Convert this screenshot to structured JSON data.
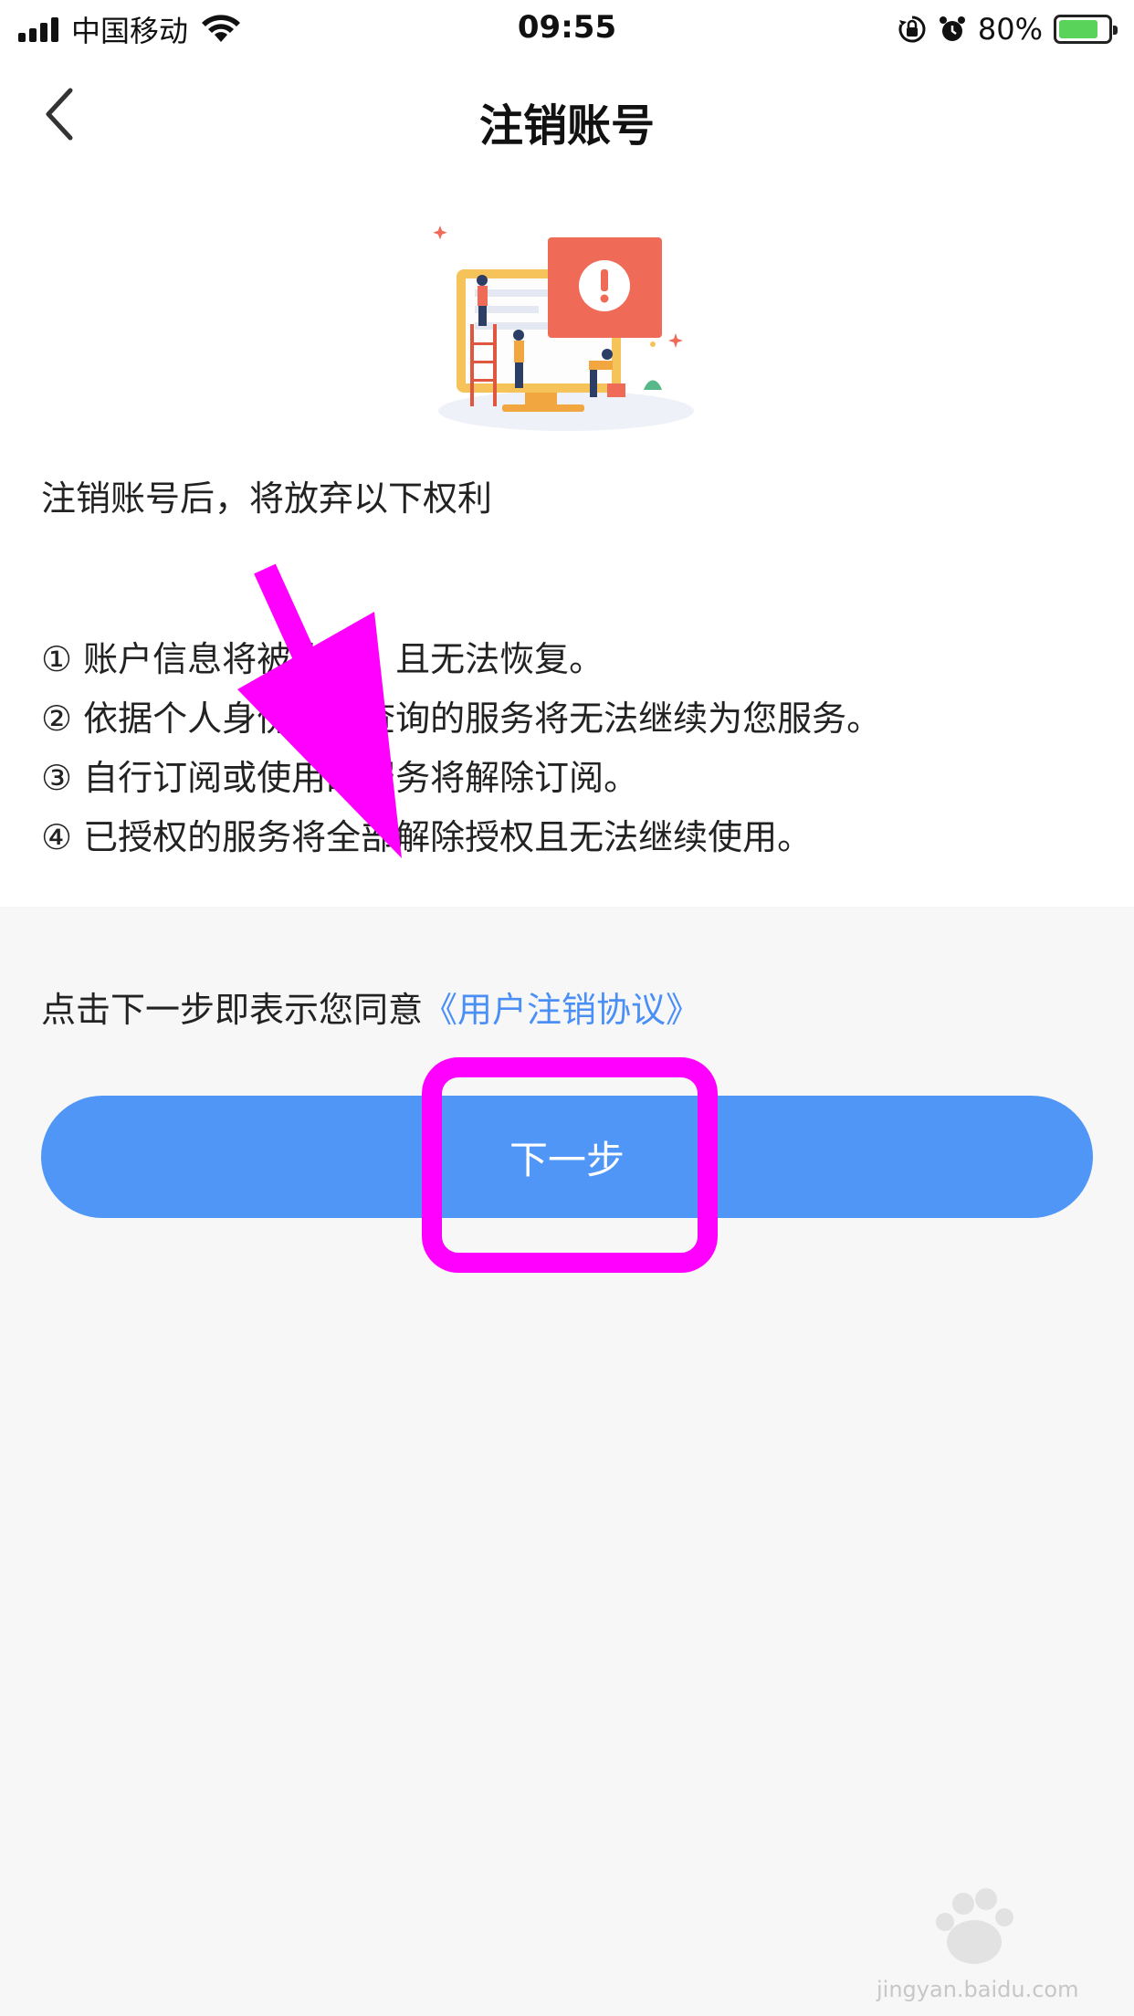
{
  "status_bar": {
    "carrier": "中国移动",
    "time": "09:55",
    "battery_percent": "80%",
    "battery_level": 0.8,
    "icons": [
      "signal-icon",
      "wifi-icon",
      "rotation-lock-icon",
      "alarm-icon",
      "battery-icon"
    ]
  },
  "nav": {
    "title": "注销账号",
    "back_icon": "chevron-left-icon"
  },
  "content": {
    "intro": "注销账号后，将放弃以下权利",
    "rights": [
      "① 账户信息将被删除，且无法恢复。",
      "② 依据个人身份信息查询的服务将无法继续为您服务。",
      "③ 自行订阅或使用的服务将解除订阅。",
      "④ 已授权的服务将全部解除授权且无法继续使用。"
    ]
  },
  "agreement": {
    "prefix": "点击下一步即表示您同意",
    "link_text": "《用户注销协议》"
  },
  "next_button": {
    "label": "下一步"
  },
  "watermark": {
    "text": "jingyan.baidu.com"
  },
  "colors": {
    "accent": "#5096f7",
    "link": "#4a8ff5",
    "annotation": "#ff00ff",
    "background": "#f7f7f8"
  }
}
